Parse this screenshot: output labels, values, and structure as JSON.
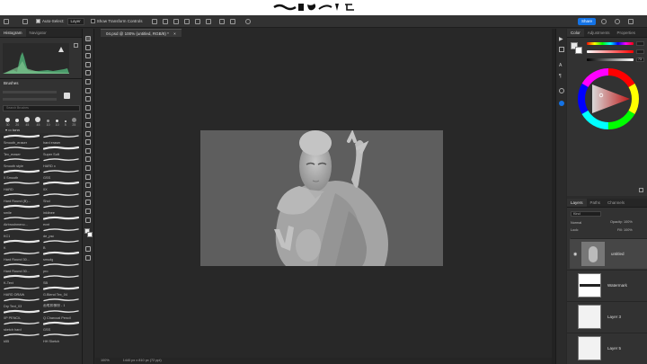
{
  "options_bar": {
    "auto_select_label": "Auto-Select:",
    "auto_select_target": "Layer",
    "transform_label": "Show Transform Controls",
    "share_label": "Share"
  },
  "left_panel": {
    "tabs": [
      "Histogram",
      "Navigator"
    ],
    "brushes_title": "Brushes",
    "search_placeholder": "Search Brushes",
    "brush_sizes": [
      "30",
      "20",
      "45",
      "45",
      "10",
      "10",
      "5",
      "25"
    ],
    "folder_name": "tonn",
    "brushes": [
      "Smooth_eraser",
      "hard eraser",
      "Tex_eraser",
      "Super Soft",
      "Smooth style",
      "HARD x",
      "0 Smooth",
      "GSS",
      "HARD",
      "0X",
      "Hard Round (B)...",
      "Shol",
      "smile",
      "inklinee",
      "Airbrushmeno...",
      "ecnt",
      "KC1",
      "de_psd",
      "K",
      "B",
      "Hard Round 30...",
      "smudg",
      "Hard Round 30...",
      "pro",
      "K-Text",
      "SB",
      "HARD DRAW",
      "G.Blend Tex_04",
      "Dry Text_03",
      "画笔和橡擦 - 1",
      "0P PENCIL",
      "Q Charcoal Pencil",
      "sketch hard",
      "GSS",
      "k55",
      "HH Sketch"
    ]
  },
  "document": {
    "tab_title": "04.psd @ 100% (untitled, RGB/8) *",
    "status_zoom": "100%",
    "status_info": "1440 px x 810 px (72 ppi)"
  },
  "color_panel": {
    "tabs": [
      "Color",
      "Adjustments",
      "Properties"
    ],
    "slider_values": [
      "",
      "",
      "73"
    ]
  },
  "layers_panel": {
    "tabs": [
      "Layers",
      "Paths",
      "Channels"
    ],
    "kind_label": "Kind",
    "blend_mode": "Normal",
    "opacity_label": "Opacity:",
    "opacity_value": "100%",
    "lock_label": "Lock:",
    "fill_label": "Fill:",
    "fill_value": "100%",
    "layers": [
      {
        "name": "untitled",
        "visible": true,
        "selected": true
      },
      {
        "name": "Watermark",
        "visible": false,
        "selected": false
      },
      {
        "name": "Layer 3",
        "visible": false,
        "selected": false
      },
      {
        "name": "Layer 5",
        "visible": false,
        "selected": false
      }
    ]
  },
  "colors": {
    "accent": "#1473e6",
    "panel_bg": "#323232",
    "canvas_bg": "#282828"
  }
}
